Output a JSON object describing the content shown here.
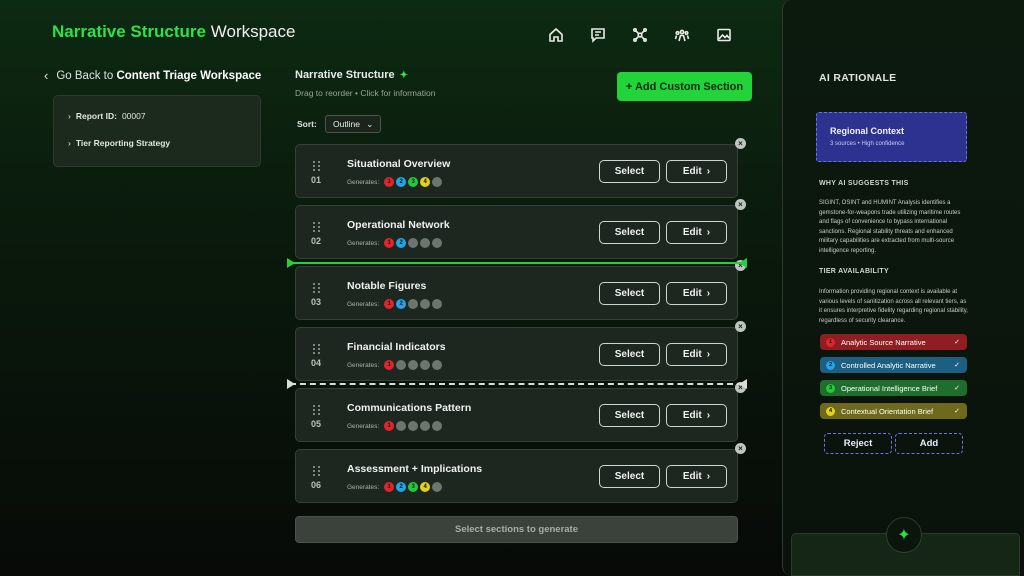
{
  "header": {
    "title_accent": "Narrative Structure",
    "title_rest": "Workspace",
    "nav_icons": [
      "home-icon",
      "chat-icon",
      "network-icon",
      "people-icon",
      "image-icon"
    ]
  },
  "back": {
    "prefix": "Go Back to",
    "target": "Content Triage Workspace"
  },
  "meta": {
    "report_label": "Report ID:",
    "report_id": "00007",
    "strategy": "Tier Reporting Strategy"
  },
  "structure": {
    "title": "Narrative Structure",
    "subtitle": "Drag to reorder • Click for information",
    "add_button": "+ Add Custom Section",
    "sort_label": "Sort:",
    "sort_value": "Outline",
    "generates_label": "Generates:",
    "select_label": "Select",
    "edit_label": "Edit",
    "generate_button": "Select sections to generate"
  },
  "tier_colors": [
    "#e0262b",
    "#1fa5e8",
    "#22c93d",
    "#e2d01c"
  ],
  "inactive_color": "#6e756e",
  "sections": [
    {
      "num": "01",
      "title": "Situational Overview",
      "tiers": [
        1,
        1,
        1,
        1,
        0
      ]
    },
    {
      "num": "02",
      "title": "Operational Network",
      "tiers": [
        1,
        1,
        0,
        0,
        0
      ]
    },
    {
      "num": "03",
      "title": "Notable Figures",
      "tiers": [
        1,
        1,
        0,
        0,
        0
      ]
    },
    {
      "num": "04",
      "title": "Financial Indicators",
      "tiers": [
        1,
        0,
        0,
        0,
        0
      ]
    },
    {
      "num": "05",
      "title": "Communications Pattern",
      "tiers": [
        1,
        0,
        0,
        0,
        0
      ]
    },
    {
      "num": "06",
      "title": "Assessment + Implications",
      "tiers": [
        1,
        1,
        1,
        1,
        0
      ]
    }
  ],
  "rationale": {
    "title": "AI RATIONALE",
    "context_title": "Regional Context",
    "context_sub": "3 sources • High confidence",
    "why_heading": "WHY AI SUGGESTS THIS",
    "why_text": "SIGINT, OSINT and HUMINT Analysis identifies a gemstone-for-weapons trade utilizing maritime routes and flags of convenience to bypass international sanctions. Regional stability threats and enhanced military capabilities are extracted from multi-source intelligence reporting.",
    "tier_heading": "TIER AVAILABILITY",
    "tier_text": "Information providing regional context is available at various levels of sanitization across all relevant tiers, as it ensures interpretive fidelity regarding regional stability, regardless of security clearance.",
    "tiers": [
      {
        "n": "1",
        "label": "Analytic Source Narrative",
        "bg": "#8e1e22",
        "dot": "#e0262b"
      },
      {
        "n": "2",
        "label": "Controlled Analytic Narrative",
        "bg": "#1c5f82",
        "dot": "#1fa5e8"
      },
      {
        "n": "3",
        "label": "Operational Intelligence Brief",
        "bg": "#1f6e2b",
        "dot": "#22c93d"
      },
      {
        "n": "4",
        "label": "Contextual Orientation Brief",
        "bg": "#6e6a1c",
        "dot": "#e2d01c"
      }
    ],
    "reject": "Reject",
    "add": "Add"
  }
}
